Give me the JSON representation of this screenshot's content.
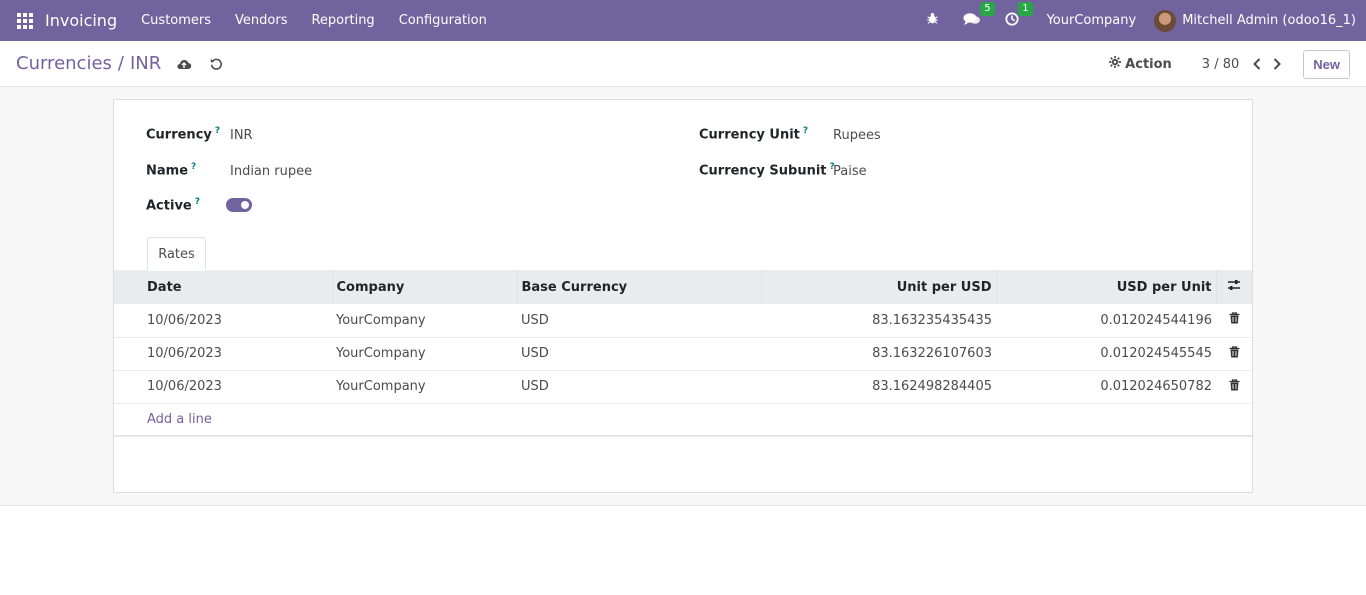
{
  "navbar": {
    "app_name": "Invoicing",
    "menu": [
      "Customers",
      "Vendors",
      "Reporting",
      "Configuration"
    ],
    "messages_badge": "5",
    "activities_badge": "1",
    "company": "YourCompany",
    "user": "Mitchell Admin (odoo16_1)"
  },
  "control_panel": {
    "breadcrumb_parent": "Currencies",
    "breadcrumb_sep": "/",
    "breadcrumb_current": "INR",
    "action_label": "Action",
    "pager": "3 / 80",
    "new_label": "New"
  },
  "form": {
    "currency_label": "Currency",
    "currency_value": "INR",
    "name_label": "Name",
    "name_value": "Indian rupee",
    "active_label": "Active",
    "active_value": true,
    "unit_label": "Currency Unit",
    "unit_value": "Rupees",
    "subunit_label": "Currency Subunit",
    "subunit_value": "Paise",
    "help_mark": "?"
  },
  "tabs": {
    "rates": "Rates"
  },
  "rates_table": {
    "headers": [
      "Date",
      "Company",
      "Base Currency",
      "Unit per USD",
      "USD per Unit"
    ],
    "rows": [
      [
        "10/06/2023",
        "YourCompany",
        "USD",
        "83.163235435435",
        "0.012024544196"
      ],
      [
        "10/06/2023",
        "YourCompany",
        "USD",
        "83.163226107603",
        "0.012024545545"
      ],
      [
        "10/06/2023",
        "YourCompany",
        "USD",
        "83.162498284405",
        "0.012024650782"
      ]
    ],
    "add_line": "Add a line"
  },
  "colors": {
    "brand": "#71639e",
    "badge": "#28a745"
  }
}
